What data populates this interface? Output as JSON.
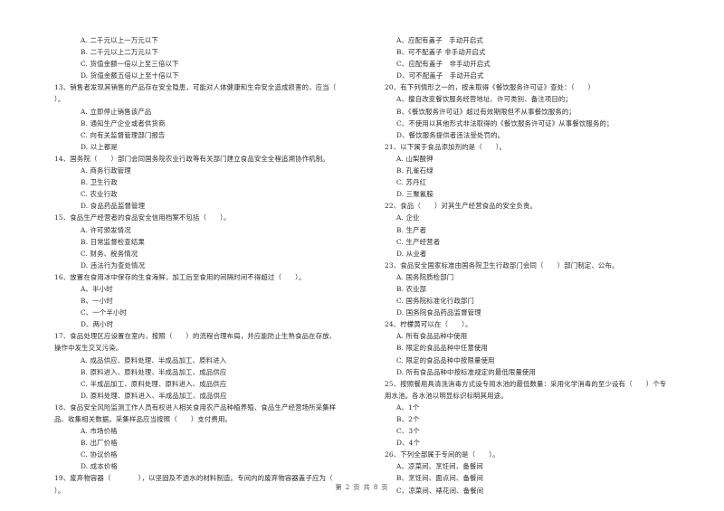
{
  "left_column": [
    {
      "type": "opt",
      "text": "A. 二千元以上一万元以下"
    },
    {
      "type": "opt",
      "text": "B. 二千元以上二万元以下"
    },
    {
      "type": "opt",
      "text": "C. 货值金额一倍以上至三倍以下"
    },
    {
      "type": "opt",
      "text": "D. 货值金额五倍以上至十倍以下"
    },
    {
      "type": "q",
      "text": "13、销售者发现其销售的产品存在安全隐患，可能对人体健康和生命安全造成损害的，应当（"
    },
    {
      "type": "q",
      "text": "）。"
    },
    {
      "type": "opt",
      "text": "A. 立即停止销售该产品"
    },
    {
      "type": "opt",
      "text": "B. 通知生产企业或者供货商"
    },
    {
      "type": "opt",
      "text": "C. 向有关监督管理部门报告"
    },
    {
      "type": "opt",
      "text": "D. 以上都是"
    },
    {
      "type": "q",
      "text": "14、国务院（　　）部门会同国务院农业行政等有关部门建立食品安全全程追溯协作机制。"
    },
    {
      "type": "opt",
      "text": "A. 商务行政管理"
    },
    {
      "type": "opt",
      "text": "B. 卫生行政"
    },
    {
      "type": "opt",
      "text": "C. 农业行政"
    },
    {
      "type": "opt",
      "text": "D. 食品药品监督管理"
    },
    {
      "type": "q",
      "text": "15、食品生产经营者的食品安全信用档案不包括（　　）。"
    },
    {
      "type": "opt",
      "text": "A. 许可颁发情况"
    },
    {
      "type": "opt",
      "text": "B. 日常监督检查结果"
    },
    {
      "type": "opt",
      "text": "C. 财务、税务情况"
    },
    {
      "type": "opt",
      "text": "D. 违法行为查处情况"
    },
    {
      "type": "q",
      "text": "16、放置在食用冰中保存的生食海鲜，加工后至食用的间隔时间不得超过（　　）。"
    },
    {
      "type": "opt",
      "text": "A、半小时"
    },
    {
      "type": "opt",
      "text": "B、一小时"
    },
    {
      "type": "opt",
      "text": "C、一个半小时"
    },
    {
      "type": "opt",
      "text": "D、两小时"
    },
    {
      "type": "q",
      "text": "17、食品处理区应设置在室内，按照（　　）的流程合理布局，并应能防止生熟食品在存放、"
    },
    {
      "type": "q",
      "text": "操作中发生交叉污染。"
    },
    {
      "type": "opt",
      "text": "A. 成品供应、原料处理、半成品加工、原料进入"
    },
    {
      "type": "opt",
      "text": "B. 原料进入、原料处理、半成品加工、成品供应"
    },
    {
      "type": "opt",
      "text": "C. 半成品加工、原料处理、原料进入、成品供应"
    },
    {
      "type": "opt",
      "text": "D. 原料处理、原料进入、半成品加工、成品供应"
    },
    {
      "type": "q",
      "text": "18、食品安全风险监测工作人员有权进入相关食用农产品种植养殖、食品生产经营场所采集样"
    },
    {
      "type": "q",
      "text": "品、收集相关数据。采集样品应当按照（　　）支付费用。"
    },
    {
      "type": "opt",
      "text": "A. 市场价格"
    },
    {
      "type": "opt",
      "text": "B. 出厂价格"
    },
    {
      "type": "opt",
      "text": "C. 协议价格"
    },
    {
      "type": "opt",
      "text": "D. 成本价格"
    },
    {
      "type": "q",
      "text": "19、废弃物容器（　　　　），以坚固及不透水的材料制造。专间内的废弃物容器盖子应为（"
    },
    {
      "type": "q",
      "text": "）。"
    }
  ],
  "right_column": [
    {
      "type": "opt",
      "text": "A、应配有盖子　手动开启式"
    },
    {
      "type": "opt",
      "text": "B、可不配盖子 非手动开启式"
    },
    {
      "type": "opt",
      "text": "C、应配有盖子　非手动开启式"
    },
    {
      "type": "opt",
      "text": "D、可不配盖子　手动开启式"
    },
    {
      "type": "q",
      "text": "20、有下列情形之一的，按未取得《餐饮服务许可证》查处：（　　）"
    },
    {
      "type": "opt",
      "text": "A、擅自改变餐饮服务经营地址、许可类别、备注项目的；"
    },
    {
      "type": "opt",
      "text": "B、《餐饮服务许可证》超过有效期限但不从事餐饮服务的；"
    },
    {
      "type": "opt",
      "text": "C、不使用以其他形式非法取得的《餐饮服务许可证》从事餐饮服务的；"
    },
    {
      "type": "opt",
      "text": "D、餐饮服务提供者违法受处罚的。"
    },
    {
      "type": "q",
      "text": "21、以下属于食品添加剂的是（　　）。"
    },
    {
      "type": "opt",
      "text": "A. 山梨酸钾"
    },
    {
      "type": "opt",
      "text": "B. 孔雀石绿"
    },
    {
      "type": "opt",
      "text": "C. 苏丹红"
    },
    {
      "type": "opt",
      "text": "D. 三聚氰胺"
    },
    {
      "type": "q",
      "text": "22、食品（　　）对其生产经营食品的安全负责。"
    },
    {
      "type": "opt",
      "text": "A. 企业"
    },
    {
      "type": "opt",
      "text": "B. 生产者"
    },
    {
      "type": "opt",
      "text": "C. 生产经营者"
    },
    {
      "type": "opt",
      "text": "D. 从业者"
    },
    {
      "type": "q",
      "text": "23、食品安全国家标准由国务院卫生行政部门会同（　　）部门制定、公布。"
    },
    {
      "type": "opt",
      "text": "A. 国务院质检部门"
    },
    {
      "type": "opt",
      "text": "B. 农业部"
    },
    {
      "type": "opt",
      "text": "C. 国务院标准化行政部门"
    },
    {
      "type": "opt",
      "text": "D. 国务院食品药品监督管理"
    },
    {
      "type": "q",
      "text": "24、柠檬黄可以在（　　）。"
    },
    {
      "type": "opt",
      "text": "A. 所有食品品种中使用"
    },
    {
      "type": "opt",
      "text": "B. 限定的食品品种中任意使用"
    },
    {
      "type": "opt",
      "text": "C. 限定的食品品种中按限量使用"
    },
    {
      "type": "opt",
      "text": "D. 所有食品品种中按标准规定的最低限量使用"
    },
    {
      "type": "q",
      "text": "25、按照餐用具清洗消毒方式设专用水池的最低数量：采用化学消毒的至少设有（　　）个专"
    },
    {
      "type": "q",
      "text": "用水池。各水池以明显标识标明其用途。"
    },
    {
      "type": "opt",
      "text": "A、1个"
    },
    {
      "type": "opt",
      "text": "B、2个"
    },
    {
      "type": "opt",
      "text": "C、3个"
    },
    {
      "type": "opt",
      "text": "D、4个"
    },
    {
      "type": "q",
      "text": "26、下列全部属于专间的是（　　）。"
    },
    {
      "type": "opt",
      "text": "A、凉菜间、烹饪间、备餐间"
    },
    {
      "type": "opt",
      "text": "B、烹饪间、面点间、备餐间"
    },
    {
      "type": "opt",
      "text": "C、凉菜间、裱花间、备餐间"
    }
  ],
  "footer": {
    "page_label": "第 2 页 共 8 页"
  }
}
